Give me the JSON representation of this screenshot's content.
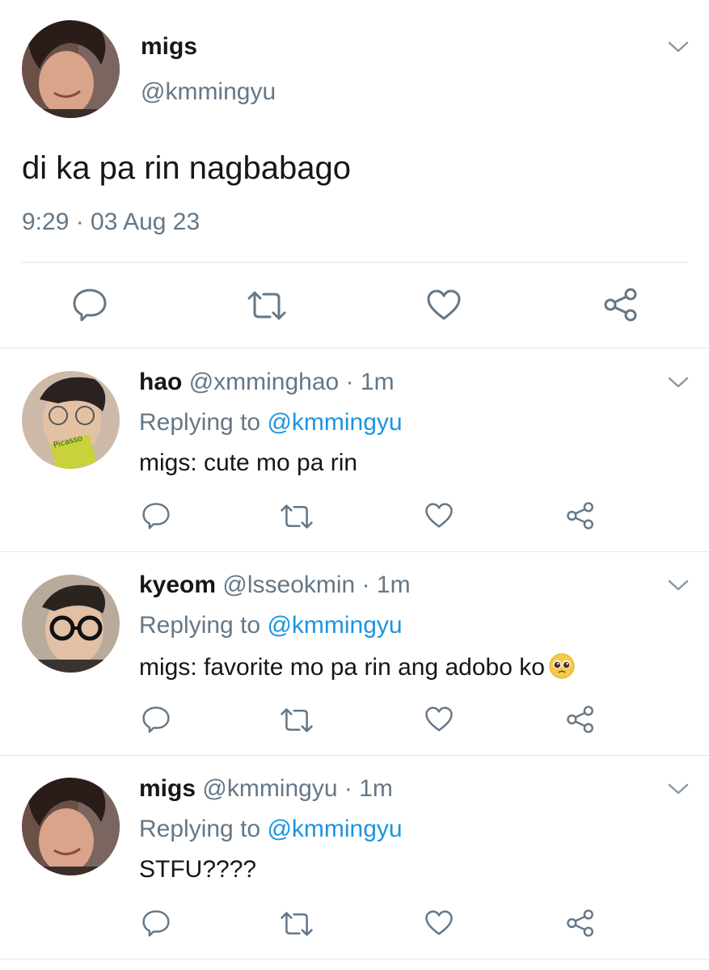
{
  "main_tweet": {
    "name": "migs",
    "handle": "@kmmingyu",
    "text": "di ka pa rin nagbabago",
    "timestamp": "9:29 · 03 Aug 23",
    "avatar": "avatar-migs",
    "actions": [
      "reply-icon",
      "retweet-icon",
      "like-icon",
      "share-icon"
    ]
  },
  "replies": [
    {
      "name": "hao",
      "handle": "@xmminghao",
      "sep": "·",
      "time": "1m",
      "replying_prefix": "Replying to ",
      "replying_to": "@kmmingyu",
      "text": "migs: cute mo pa rin",
      "avatar": "avatar-hao"
    },
    {
      "name": "kyeom",
      "handle": "@lsseokmin",
      "sep": "·",
      "time": "1m",
      "replying_prefix": "Replying to ",
      "replying_to": "@kmmingyu",
      "text": "migs: favorite mo pa rin ang adobo ko",
      "emoji": "pleading-face-emoji",
      "avatar": "avatar-kyeom"
    },
    {
      "name": "migs",
      "handle": "@kmmingyu",
      "sep": "·",
      "time": "1m",
      "replying_prefix": "Replying to ",
      "replying_to": "@kmmingyu",
      "text": "STFU????",
      "avatar": "avatar-migs"
    }
  ],
  "colors": {
    "text": "#14171a",
    "secondary": "#657786",
    "link": "#1b95e0",
    "icon": "#657786",
    "divider": "#e1e8ed"
  }
}
